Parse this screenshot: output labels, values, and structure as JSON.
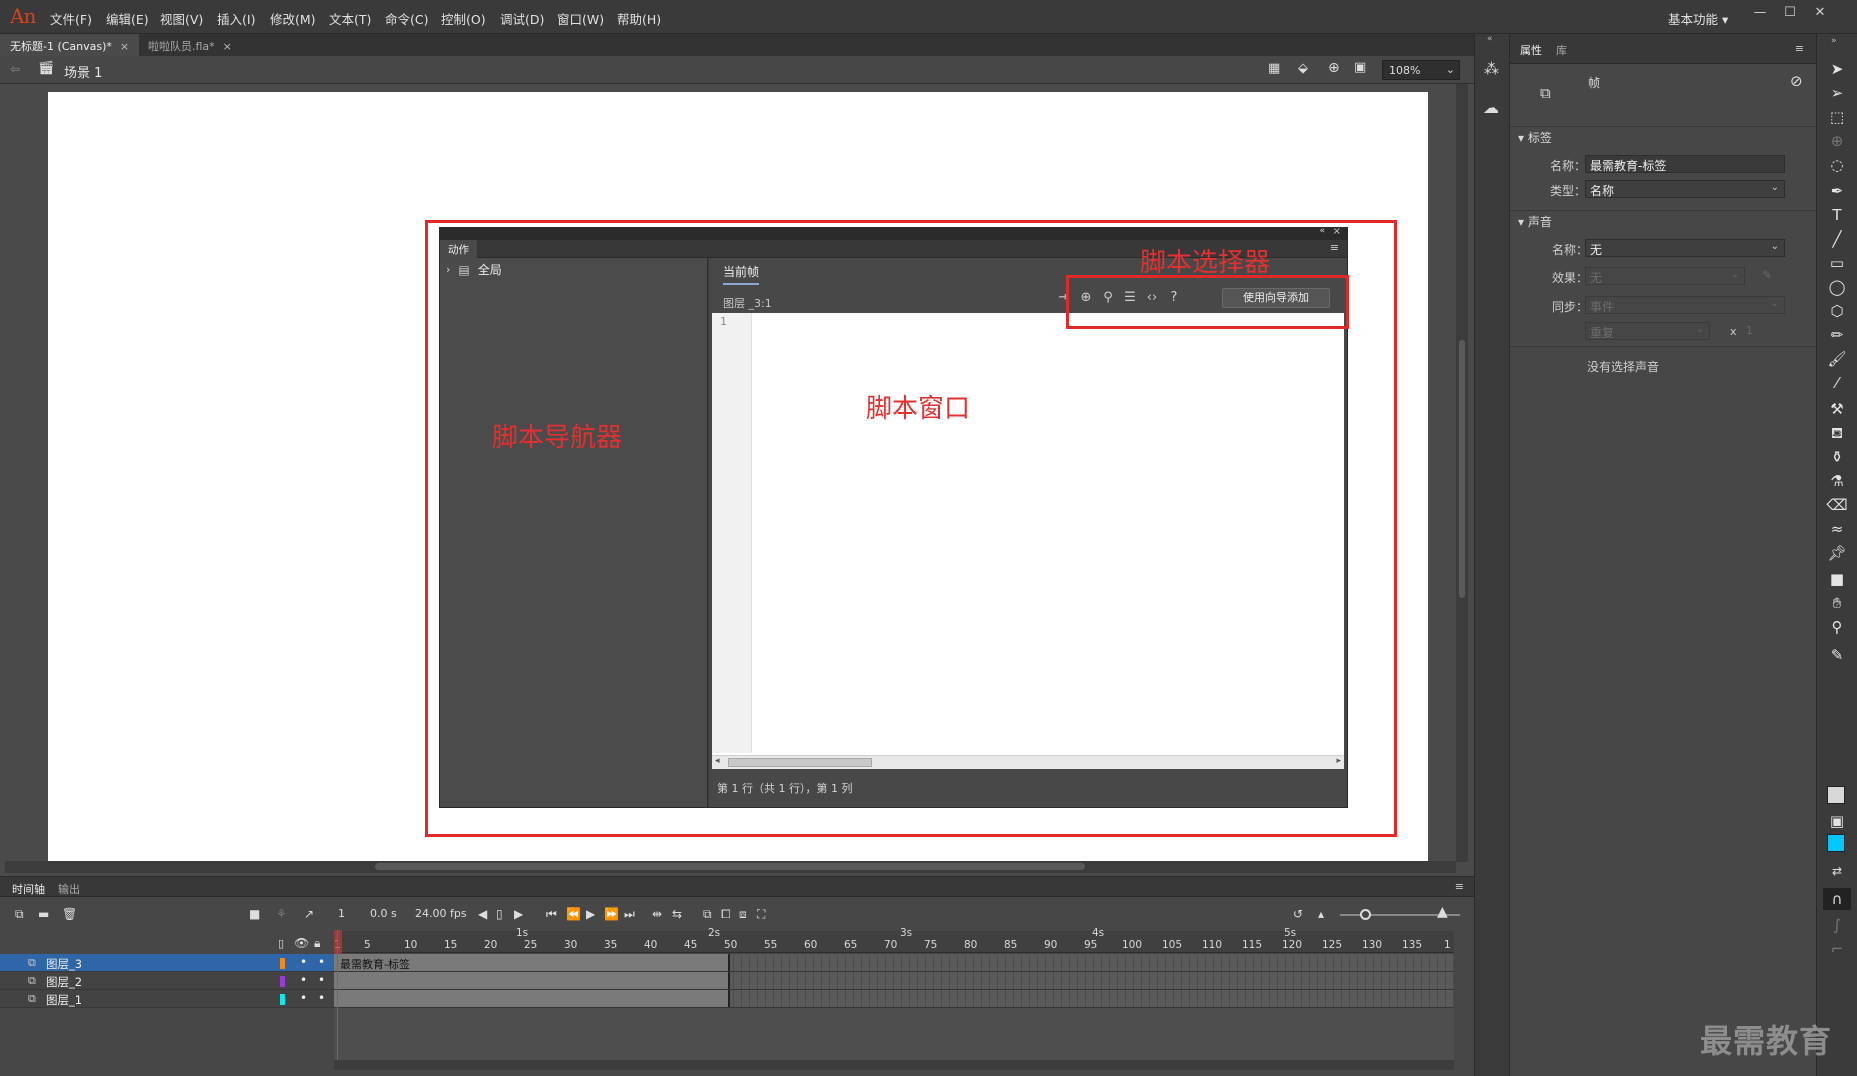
{
  "menubar": {
    "logo": "An",
    "items": [
      "文件(F)",
      "编辑(E)",
      "视图(V)",
      "插入(I)",
      "修改(M)",
      "文本(T)",
      "命令(C)",
      "控制(O)",
      "调试(D)",
      "窗口(W)",
      "帮助(H)"
    ],
    "workspace": "基本功能"
  },
  "doc_tabs": [
    {
      "label": "无标题-1 (Canvas)*",
      "active": true
    },
    {
      "label": "啦啦队员.fla*",
      "active": false
    }
  ],
  "scene": {
    "label": "场景 1",
    "zoom": "108%"
  },
  "actions_panel": {
    "tab": "动作",
    "navigator": {
      "item": "全局"
    },
    "current_frame_tab": "当前帧",
    "frame_path": "图层 _3:1",
    "wizard_button": "使用向导添加",
    "line_number": "1",
    "status": "第 1 行（共 1 行），第 1 列"
  },
  "annotations": {
    "selector": "脚本选择器",
    "window": "脚本窗口",
    "navigator": "脚本导航器"
  },
  "properties": {
    "tabs": [
      "属性",
      "库"
    ],
    "type_label": "帧",
    "label_section": "标签",
    "name_label": "名称：",
    "name_value": "最需教育-标签",
    "type_field_label": "类型：",
    "type_value": "名称",
    "sound_section": "声音",
    "sound_name_label": "名称：",
    "sound_name_value": "无",
    "effect_label": "效果：",
    "effect_value": "无",
    "sync_label": "同步：",
    "sync_value": "事件",
    "repeat_value": "重复",
    "repeat_x": "x",
    "repeat_count": "1",
    "no_sound": "没有选择声音"
  },
  "timeline": {
    "tabs": [
      "时间轴",
      "输出"
    ],
    "current_frame": "1",
    "time": "0.0 s",
    "fps": "24.00 fps",
    "seconds": [
      "1s",
      "2s",
      "3s",
      "4s",
      "5s"
    ],
    "ticks": [
      "1",
      "5",
      "10",
      "15",
      "20",
      "25",
      "30",
      "35",
      "40",
      "45",
      "50",
      "55",
      "60",
      "65",
      "70",
      "75",
      "80",
      "85",
      "90",
      "95",
      "100",
      "105",
      "110",
      "115",
      "120",
      "125",
      "130",
      "135",
      "1"
    ],
    "layers": [
      {
        "name": "图层_3",
        "color": "#f08a1e",
        "selected": true
      },
      {
        "name": "图层_2",
        "color": "#9b3bd1",
        "selected": false
      },
      {
        "name": "图层_1",
        "color": "#19e3e8",
        "selected": false
      }
    ],
    "frame_label": "最需教育-标签"
  },
  "watermark": "最需教育"
}
